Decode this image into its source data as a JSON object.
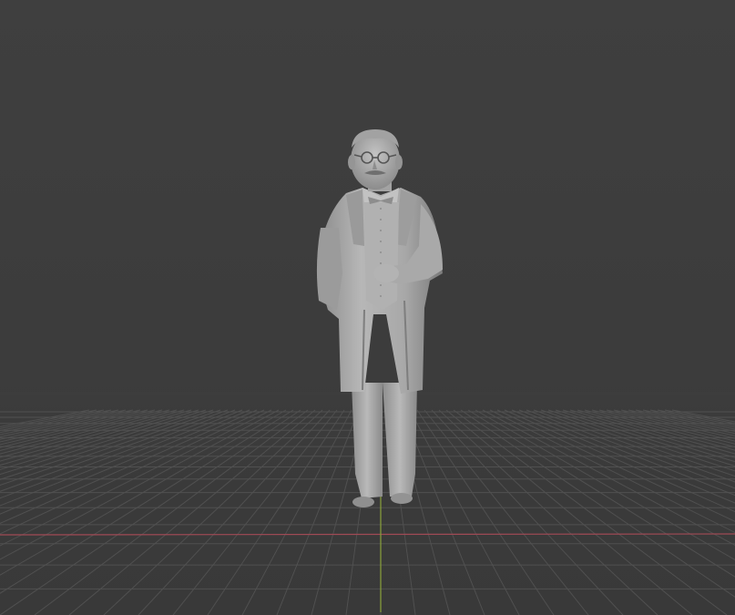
{
  "app": {
    "view": "3D Viewport",
    "shading": "solid"
  },
  "scene": {
    "object": "statue-figure",
    "colors": {
      "background": "#3d3d3d",
      "grid_line": "#4f4f4f",
      "x_axis": "#a04a55",
      "y_axis": "#8aa23a",
      "model_light": "#bdbdbd",
      "model_mid": "#9e9e9e",
      "model_dark": "#6e6e6e"
    }
  }
}
